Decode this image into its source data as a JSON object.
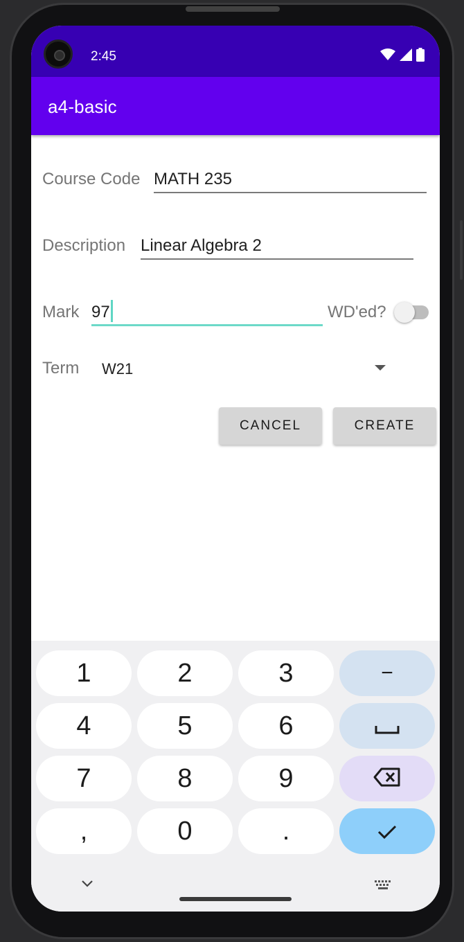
{
  "status_bar": {
    "time": "2:45"
  },
  "app_bar": {
    "title": "a4-basic"
  },
  "form": {
    "course_code": {
      "label": "Course Code",
      "value": "MATH 235"
    },
    "description": {
      "label": "Description",
      "value": "Linear Algebra 2"
    },
    "mark": {
      "label": "Mark",
      "value": "97"
    },
    "wd": {
      "label": "WD'ed?",
      "checked": false
    },
    "term": {
      "label": "Term",
      "selected": "W21"
    }
  },
  "buttons": {
    "cancel": "CANCEL",
    "create": "CREATE"
  },
  "keyboard": {
    "rows": [
      [
        "1",
        "2",
        "3",
        "−"
      ],
      [
        "4",
        "5",
        "6",
        "space"
      ],
      [
        "7",
        "8",
        "9",
        "backspace"
      ],
      [
        ",",
        "0",
        ".",
        "done"
      ]
    ],
    "k1": "1",
    "k2": "2",
    "k3": "3",
    "minus": "−",
    "k4": "4",
    "k5": "5",
    "k6": "6",
    "k7": "7",
    "k8": "8",
    "k9": "9",
    "comma": ",",
    "k0": "0",
    "period": "."
  },
  "colors": {
    "status_bar": "#3700b3",
    "app_bar": "#6200ee",
    "accent": "#6cd9c8",
    "key_done": "#8ecffa"
  },
  "icons": [
    "wifi-icon",
    "signal-icon",
    "battery-icon",
    "backspace-icon",
    "checkmark-icon",
    "space-icon",
    "chevron-down-icon",
    "keyboard-icon",
    "dropdown-arrow-icon"
  ]
}
